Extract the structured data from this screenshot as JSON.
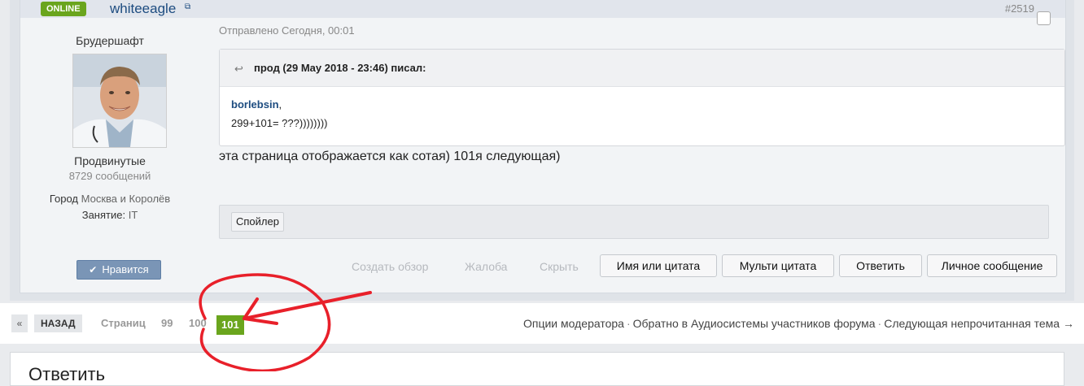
{
  "header": {
    "online_badge": "ONLINE",
    "username": "whiteeagle",
    "post_number": "#2519"
  },
  "author": {
    "title": "Брудершафт",
    "group": "Продвинутые",
    "post_count": "8729 сообщений",
    "city_label": "Город",
    "city_value": "Москва и Королёв",
    "occupation_label": "Занятие:",
    "occupation_value": "IT",
    "like_label": "Нравится"
  },
  "post": {
    "sent": "Отправлено Сегодня, 00:01",
    "quote_cite": "прод (29 May 2018 - 23:46) писал:",
    "quote_mention": "borlebsin",
    "quote_mention_suffix": ",",
    "quote_line2": "299+101= ???))))))))",
    "text": "эта страница отображается как сотая) 101я следующая)",
    "spoiler_label": "Спойлер"
  },
  "actions": {
    "create_review": "Создать обзор",
    "complaint": "Жалоба",
    "hide": "Скрыть",
    "name_or_quote": "Имя или цитата",
    "multi_quote": "Мульти цитата",
    "reply": "Ответить",
    "private_message": "Личное сообщение"
  },
  "pager": {
    "prev": "«",
    "back": "НАЗАД",
    "label": "Страниц",
    "pages": [
      "99",
      "100",
      "101"
    ],
    "current": "101"
  },
  "footer_links": {
    "moderator_options": "Опции модератора",
    "back_to_forum": "Обратно в Аудиосистемы участников форума",
    "next_unread": "Следующая непрочитанная тема →",
    "separator": "·"
  },
  "reply": {
    "title": "Ответить"
  },
  "colors": {
    "accent_green": "#6aa51d",
    "link_blue": "#1d4c80",
    "annotation_red": "#e8202a"
  },
  "icons": {
    "external_link": "external-link-icon",
    "quote": "quote-arrow-icon",
    "check": "check-icon"
  }
}
